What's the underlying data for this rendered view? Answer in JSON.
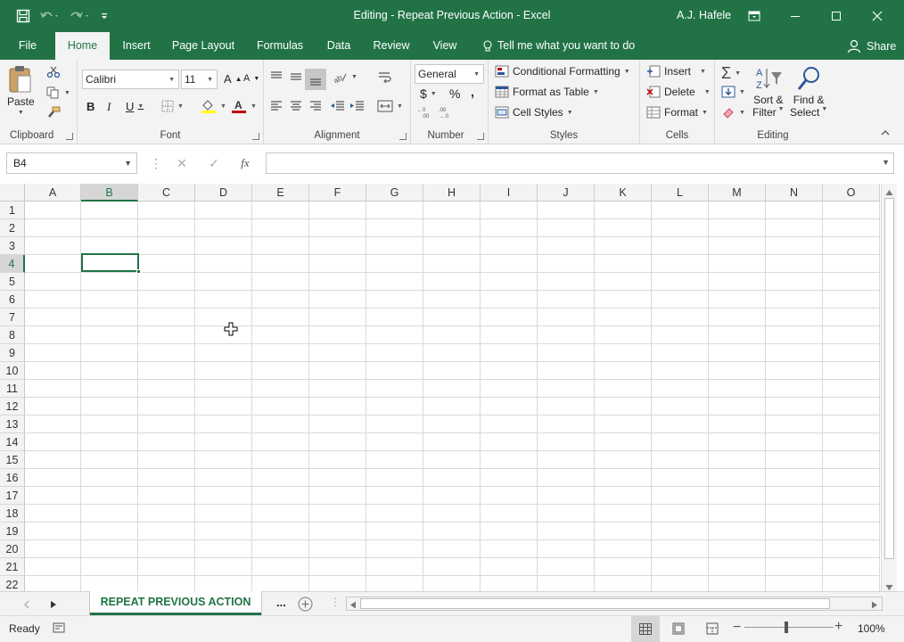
{
  "app": {
    "title": "Editing - Repeat Previous Action  -  Excel",
    "user": "A.J. Hafele",
    "accent": "#217346"
  },
  "tabs": [
    {
      "label": "File"
    },
    {
      "label": "Home"
    },
    {
      "label": "Insert"
    },
    {
      "label": "Page Layout"
    },
    {
      "label": "Formulas"
    },
    {
      "label": "Data"
    },
    {
      "label": "Review"
    },
    {
      "label": "View"
    }
  ],
  "tell_me": "Tell me what you want to do",
  "share": "Share",
  "ribbon": {
    "clipboard": {
      "label": "Clipboard",
      "paste": "Paste"
    },
    "font": {
      "label": "Font",
      "name": "Calibri",
      "size": "11"
    },
    "alignment": {
      "label": "Alignment"
    },
    "number": {
      "label": "Number",
      "format": "General",
      "currency": "$",
      "percent": "%",
      "comma": ","
    },
    "styles": {
      "label": "Styles",
      "conditional": "Conditional Formatting",
      "table": "Format as Table",
      "cell_styles": "Cell Styles"
    },
    "cells": {
      "label": "Cells",
      "insert": "Insert",
      "delete": "Delete",
      "format": "Format"
    },
    "editing": {
      "label": "Editing",
      "sort_line1": "Sort &",
      "sort_line2": "Filter",
      "find_line1": "Find &",
      "find_line2": "Select"
    }
  },
  "formula_bar": {
    "name_box": "B4",
    "fx": "fx",
    "value": ""
  },
  "grid": {
    "columns": [
      "A",
      "B",
      "C",
      "D",
      "E",
      "F",
      "G",
      "H",
      "I",
      "J",
      "K",
      "L",
      "M",
      "N",
      "O"
    ],
    "rows": [
      "1",
      "2",
      "3",
      "4",
      "5",
      "6",
      "7",
      "8",
      "9",
      "10",
      "11",
      "12",
      "13",
      "14",
      "15",
      "16",
      "17",
      "18",
      "19",
      "20",
      "21",
      "22"
    ],
    "selected_column": "B",
    "selected_row": "4"
  },
  "sheet": {
    "tab": "REPEAT PREVIOUS ACTION",
    "more": "..."
  },
  "status": {
    "ready": "Ready",
    "zoom": "100%"
  }
}
